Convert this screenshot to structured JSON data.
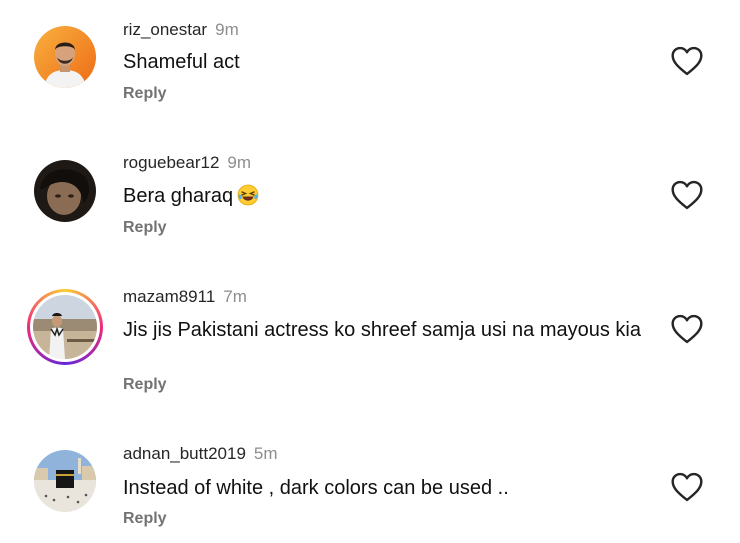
{
  "comments": [
    {
      "username": "riz_onestar",
      "time": "9m",
      "text": "Shameful act",
      "reply_label": "Reply",
      "like_icon": "heart-outline-icon",
      "avatar_colors": [
        "#f6a23a",
        "#f07c1e"
      ]
    },
    {
      "username": "roguebear12",
      "time": "9m",
      "text": "Bera gharaq",
      "emoji": "😂",
      "reply_label": "Reply",
      "like_icon": "heart-outline-icon",
      "avatar_colors": [
        "#2b2420",
        "#6b5a4b"
      ]
    },
    {
      "username": "mazam8911",
      "time": "7m",
      "text": "Jis jis Pakistani actress ko shreef samja usi na mayous kia",
      "reply_label": "Reply",
      "like_icon": "heart-outline-icon",
      "has_story_ring": true,
      "avatar_colors": [
        "#c8cfd8",
        "#a99880"
      ]
    },
    {
      "username": "adnan_butt2019",
      "time": "5m",
      "text": "Instead of white , dark colors can be used ..",
      "reply_label": "Reply",
      "like_icon": "heart-outline-icon",
      "avatar_colors": [
        "#7fa6d1",
        "#c9b89a"
      ]
    }
  ],
  "colors": {
    "username": "#262626",
    "secondary_text": "#8e8e8e",
    "reply": "#737373",
    "heart_stroke": "#262626"
  }
}
